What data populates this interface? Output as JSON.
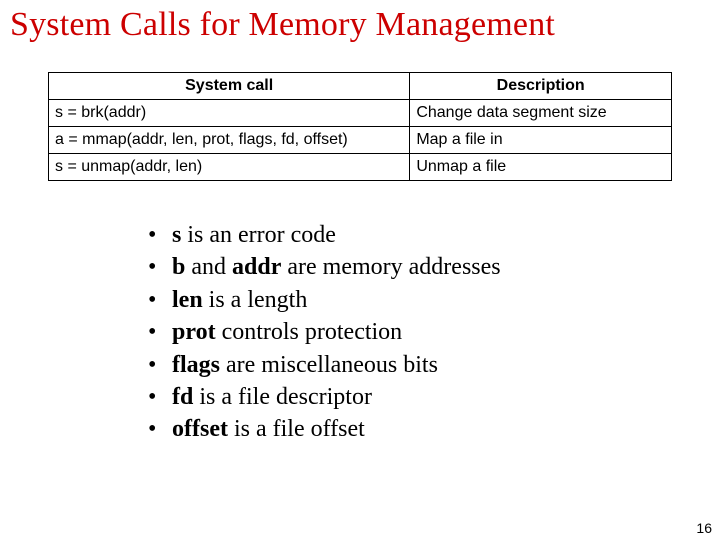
{
  "title": "System Calls for Memory Management",
  "table": {
    "headers": {
      "call": "System call",
      "desc": "Description"
    },
    "rows": [
      {
        "call": "s = brk(addr)",
        "desc": "Change data segment size"
      },
      {
        "call": "a = mmap(addr, len, prot, flags, fd, offset)",
        "desc": "Map a file in"
      },
      {
        "call": "s = unmap(addr, len)",
        "desc": "Unmap a file"
      }
    ]
  },
  "bullets": [
    {
      "bold": "s",
      "rest": " is an error  code"
    },
    {
      "bold": "b",
      "rest": " and ",
      "bold2": "addr",
      "rest2": " are memory addresses"
    },
    {
      "bold": "len",
      "rest": " is a length"
    },
    {
      "bold": "prot",
      "rest": " controls protection"
    },
    {
      "bold": "flags",
      "rest": " are miscellaneous bits"
    },
    {
      "bold": "fd",
      "rest": " is a file descriptor"
    },
    {
      "bold": "offset",
      "rest": " is a file offset"
    }
  ],
  "page_number": "16",
  "bullet_char": "•"
}
